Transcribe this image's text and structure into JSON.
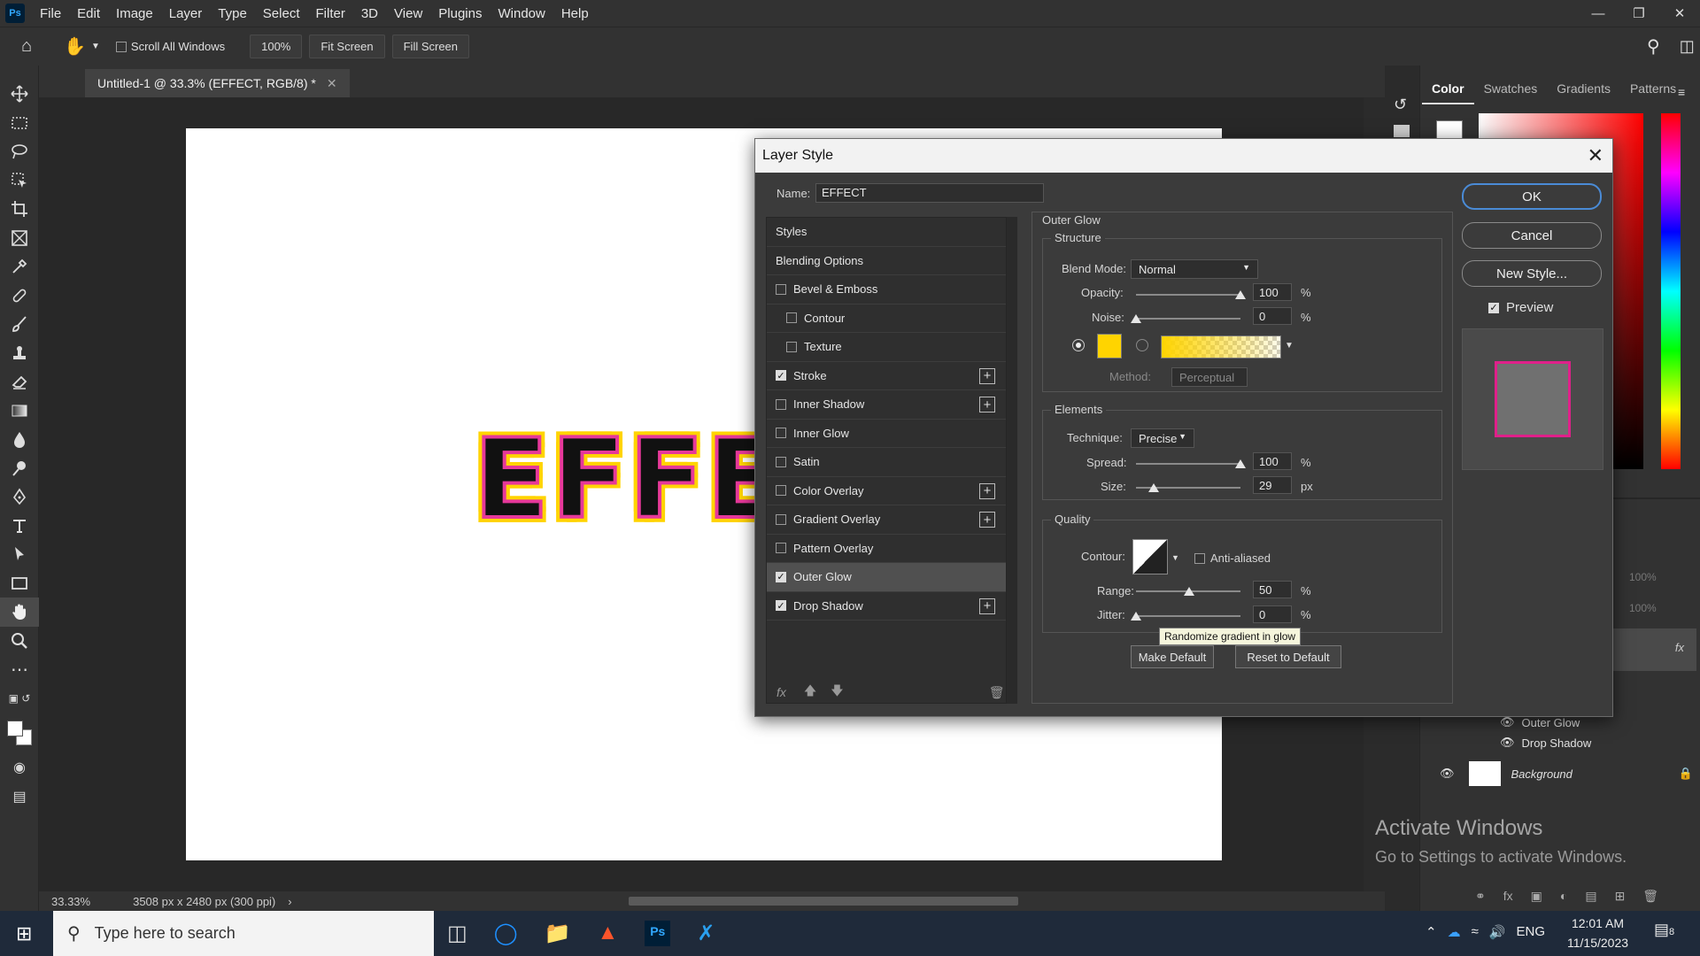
{
  "menubar": {
    "items": [
      "File",
      "Edit",
      "Image",
      "Layer",
      "Type",
      "Select",
      "Filter",
      "3D",
      "View",
      "Plugins",
      "Window",
      "Help"
    ]
  },
  "options": {
    "scroll_all": "Scroll All Windows",
    "zoom": "100%",
    "fit": "Fit Screen",
    "fill": "Fill Screen"
  },
  "document": {
    "tab": "Untitled-1 @ 33.3% (EFFECT, RGB/8) *",
    "canvas_text": "EFFE",
    "zoom": "33.33%",
    "size": "3508 px x 2480 px (300 ppi)"
  },
  "panel": {
    "tabs": [
      "Color",
      "Swatches",
      "Gradients",
      "Patterns"
    ],
    "layers": [
      {
        "label": "Outer Glow"
      },
      {
        "label": "Drop Shadow"
      },
      {
        "label": "Background"
      }
    ],
    "opacity": "100%",
    "fill": "100%"
  },
  "watermark": {
    "title": "Activate Windows",
    "sub": "Go to Settings to activate Windows."
  },
  "taskbar": {
    "search": "Type here to search",
    "time": "12:01 AM",
    "date": "11/15/2023",
    "lang": "ENG",
    "notif": "8"
  },
  "dialog": {
    "title": "Layer Style",
    "name_label": "Name:",
    "name_value": "EFFECT",
    "styles": [
      {
        "label": "Styles",
        "type": "header"
      },
      {
        "label": "Blending Options",
        "type": "header"
      },
      {
        "label": "Bevel & Emboss",
        "checked": false
      },
      {
        "label": "Contour",
        "checked": false,
        "indent": true
      },
      {
        "label": "Texture",
        "checked": false,
        "indent": true
      },
      {
        "label": "Stroke",
        "checked": true,
        "plus": true
      },
      {
        "label": "Inner Shadow",
        "checked": false,
        "plus": true
      },
      {
        "label": "Inner Glow",
        "checked": false
      },
      {
        "label": "Satin",
        "checked": false
      },
      {
        "label": "Color Overlay",
        "checked": false,
        "plus": true
      },
      {
        "label": "Gradient Overlay",
        "checked": false,
        "plus": true
      },
      {
        "label": "Pattern Overlay",
        "checked": false
      },
      {
        "label": "Outer Glow",
        "checked": true,
        "selected": true
      },
      {
        "label": "Drop Shadow",
        "checked": true,
        "plus": true
      }
    ],
    "section": "Outer Glow",
    "structure": "Structure",
    "blend_label": "Blend Mode:",
    "blend_value": "Normal",
    "opacity_label": "Opacity:",
    "opacity_value": "100",
    "noise_label": "Noise:",
    "noise_value": "0",
    "glow_color": "#ffd400",
    "method_label": "Method:",
    "method_value": "Perceptual",
    "elements": "Elements",
    "technique_label": "Technique:",
    "technique_value": "Precise",
    "spread_label": "Spread:",
    "spread_value": "100",
    "size_label": "Size:",
    "size_value": "29",
    "px": "px",
    "quality": "Quality",
    "contour_label": "Contour:",
    "anti": "Anti-aliased",
    "range_label": "Range:",
    "range_value": "50",
    "jitter_label": "Jitter:",
    "jitter_value": "0",
    "pct": "%",
    "tooltip": "Randomize gradient in glow",
    "make_default": "Make Default",
    "reset_default": "Reset to Default",
    "ok": "OK",
    "cancel": "Cancel",
    "new_style": "New Style...",
    "preview": "Preview"
  }
}
